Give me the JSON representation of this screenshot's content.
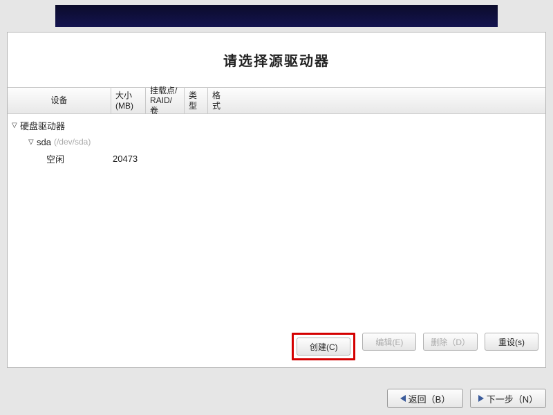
{
  "title": "请选择源驱动器",
  "columns": {
    "device": "设备",
    "size_l1": "大小",
    "size_l2": "(MB)",
    "mount_l1": "挂载点/",
    "mount_l2": "RAID/卷",
    "type": "类型",
    "format": "格式"
  },
  "tree": {
    "root_label": "硬盘驱动器",
    "drive_name": "sda",
    "drive_path": "(/dev/sda)",
    "free_label": "空闲",
    "free_size": "20473"
  },
  "actions": {
    "create": "创建(C)",
    "edit": "编辑(E)",
    "delete": "删除（D）",
    "reset": "重设(s)"
  },
  "nav": {
    "back": "返回（B）",
    "next": "下一步（N）"
  }
}
